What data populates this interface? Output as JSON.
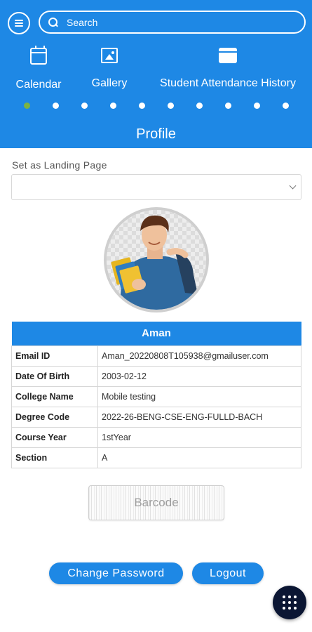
{
  "header": {
    "search_placeholder": "Search",
    "quick_links": [
      {
        "label": "Calendar",
        "icon": "calendar-icon"
      },
      {
        "label": "Gallery",
        "icon": "gallery-icon"
      },
      {
        "label": "Student Attendance History",
        "icon": "attendance-icon"
      }
    ],
    "pager": {
      "count": 10,
      "active": 1
    },
    "title": "Profile"
  },
  "landing": {
    "label": "Set as Landing Page",
    "selected": ""
  },
  "profile": {
    "name": "Aman",
    "rows": [
      {
        "label": "Email ID",
        "value": "Aman_20220808T105938@gmailuser.com"
      },
      {
        "label": "Date Of Birth",
        "value": "2003-02-12"
      },
      {
        "label": "College Name",
        "value": "Mobile testing"
      },
      {
        "label": "Degree Code",
        "value": "2022-26-BENG-CSE-ENG-FULLD-BACH"
      },
      {
        "label": "Course Year",
        "value": "1stYear"
      },
      {
        "label": "Section",
        "value": "A"
      }
    ]
  },
  "barcode": {
    "label": "Barcode"
  },
  "actions": {
    "change_password": "Change Password",
    "logout": "Logout"
  },
  "fab": {
    "icon": "grid-menu-icon"
  },
  "colors": {
    "primary": "#1e88e5",
    "active_dot": "#7cb342",
    "fab": "#0b1633"
  }
}
